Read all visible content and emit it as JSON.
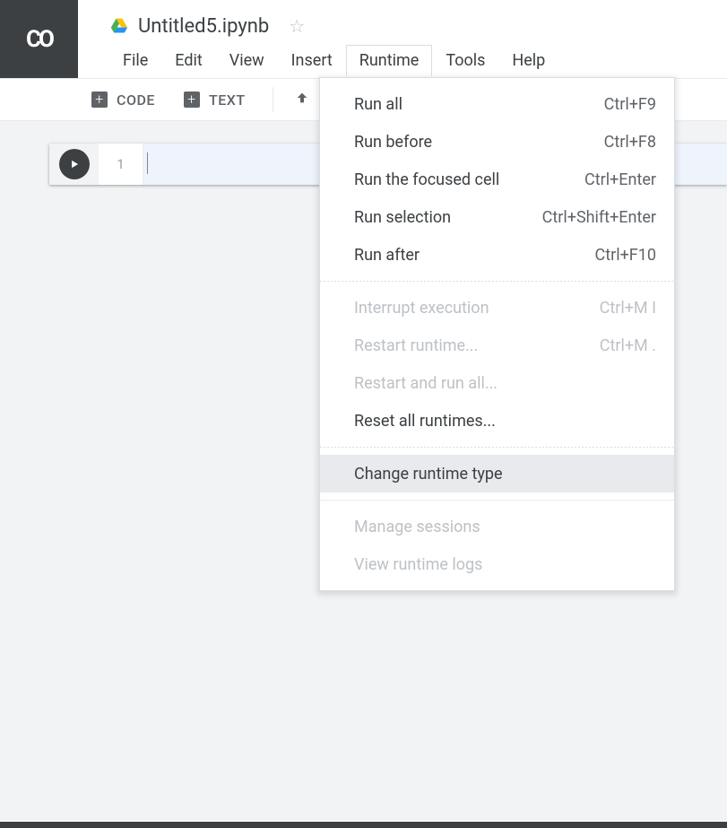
{
  "logo_text": "CO",
  "header": {
    "doc_title": "Untitled5.ipynb",
    "menubar": {
      "file": "File",
      "edit": "Edit",
      "view": "View",
      "insert": "Insert",
      "runtime": "Runtime",
      "tools": "Tools",
      "help": "Help"
    }
  },
  "toolbar": {
    "code_label": "CODE",
    "text_label": "TEXT"
  },
  "cell": {
    "line_number": "1"
  },
  "runtime_menu": {
    "run_all": {
      "label": "Run all",
      "shortcut": "Ctrl+F9"
    },
    "run_before": {
      "label": "Run before",
      "shortcut": "Ctrl+F8"
    },
    "run_focused": {
      "label": "Run the focused cell",
      "shortcut": "Ctrl+Enter"
    },
    "run_selection": {
      "label": "Run selection",
      "shortcut": "Ctrl+Shift+Enter"
    },
    "run_after": {
      "label": "Run after",
      "shortcut": "Ctrl+F10"
    },
    "interrupt": {
      "label": "Interrupt execution",
      "shortcut": "Ctrl+M I"
    },
    "restart": {
      "label": "Restart runtime...",
      "shortcut": "Ctrl+M ."
    },
    "restart_run_all": {
      "label": "Restart and run all..."
    },
    "reset_all": {
      "label": "Reset all runtimes..."
    },
    "change_type": {
      "label": "Change runtime type"
    },
    "manage_sessions": {
      "label": "Manage sessions"
    },
    "view_logs": {
      "label": "View runtime logs"
    }
  }
}
